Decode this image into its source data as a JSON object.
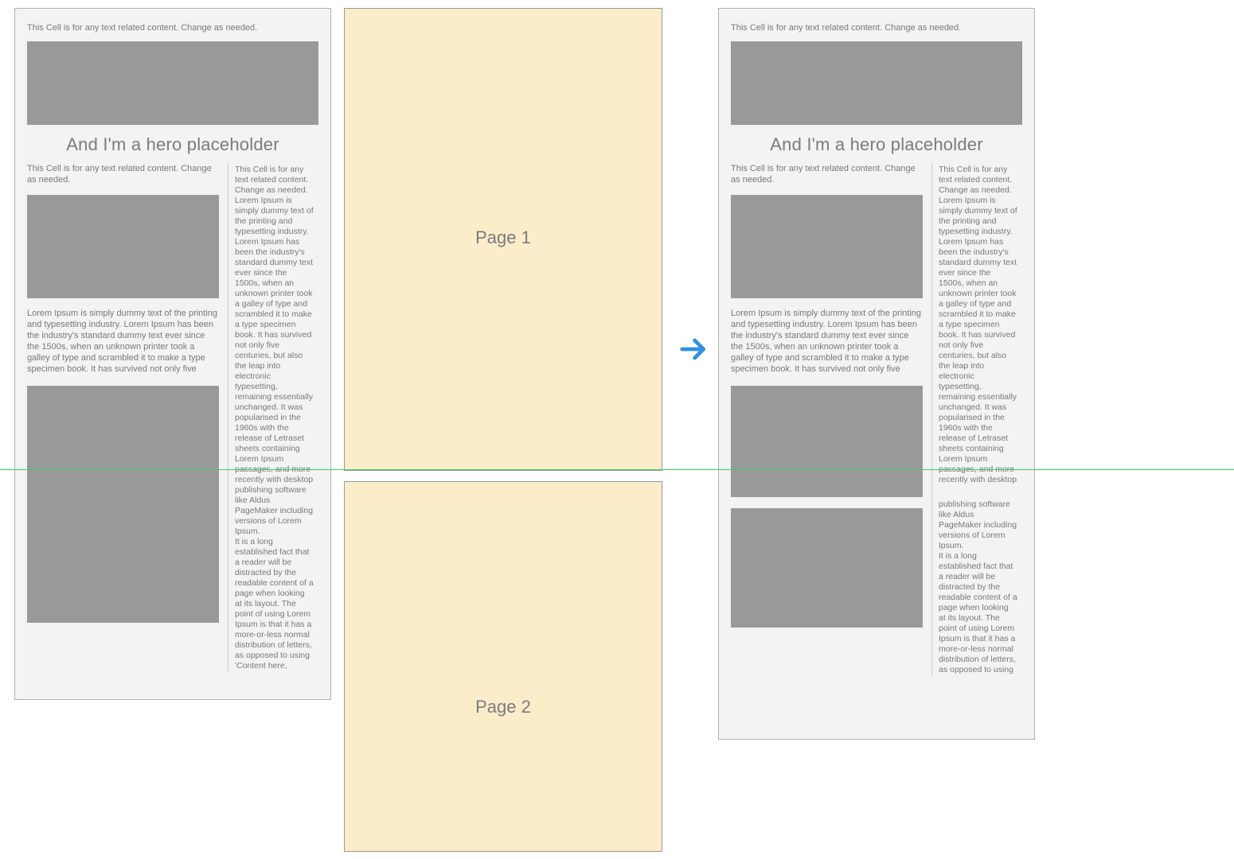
{
  "shared": {
    "top_caption": "This Cell is for any text related content. Change as needed.",
    "hero_title": "And I'm a hero placeholder",
    "left_column": {
      "caption": "This Cell is for any text related content. Change as needed.",
      "paragraph": "Lorem Ipsum is simply dummy text of the printing and typesetting industry. Lorem Ipsum has been the industry's standard dummy text ever since the 1500s, when an unknown printer took a galley of type and scrambled it to make a type specimen book. It has survived not only five"
    },
    "right_column_full": "This Cell is for any text related content. Change as needed. Lorem Ipsum is simply dummy text of the printing and typesetting industry. Lorem Ipsum has been the industry's standard dummy text ever since the 1500s, when an unknown printer took a galley of type and scrambled it to make a type specimen book. It has survived not only five centuries, but also the leap into electronic typesetting, remaining essentially unchanged. It was popularised in the 1960s with the release of Letraset sheets containing Lorem Ipsum passages, and more recently with desktop publishing software like Aldus PageMaker including versions of Lorem Ipsum.\nIt is a long established fact that a reader will be distracted by the readable content of a page when looking at its layout. The point of using Lorem Ipsum is that it has a more-or-less normal distribution of letters, as opposed to using 'Content here,",
    "right_column_part1": "This Cell is for any text related content. Change as needed. Lorem Ipsum is simply dummy text of the printing and typesetting industry. Lorem Ipsum has been the industry's standard dummy text ever since the 1500s, when an unknown printer took a galley of type and scrambled it to make a type specimen book. It has survived not only five centuries, but also the leap into electronic typesetting, remaining essentially unchanged. It was popularised in the 1960s with the release of Letraset sheets containing Lorem Ipsum passages, and more recently with desktop",
    "right_column_part2": "publishing software like Aldus PageMaker including versions of Lorem Ipsum.\nIt is a long established fact that a reader will be distracted by the readable content of a page when looking at its layout. The point of using Lorem Ipsum is that it has a more-or-less normal distribution of letters, as opposed to using"
  },
  "pages": {
    "page1_label": "Page 1",
    "page2_label": "Page 2"
  },
  "colors": {
    "page_fill": "#fcedca",
    "panel_fill": "#f3f3f3",
    "placeholder_gray": "#999999",
    "accent_blue": "#2f8fe6",
    "guide_green": "#3fcf6a"
  }
}
